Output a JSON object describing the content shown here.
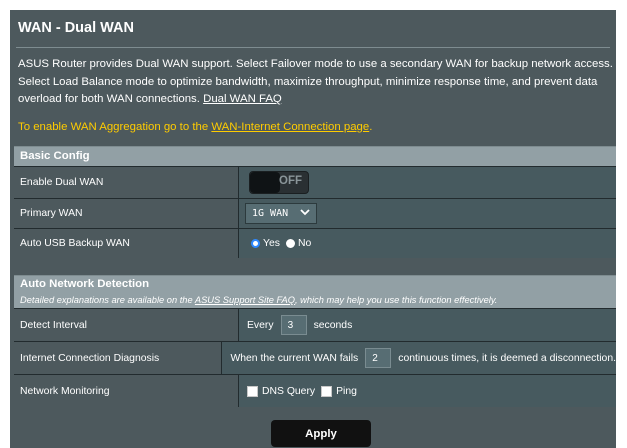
{
  "page": {
    "title": "WAN - Dual WAN",
    "description": "ASUS Router provides Dual WAN support. Select Failover mode to use a secondary WAN for backup network access. Select Load Balance mode to optimize bandwidth, maximize throughput, minimize response time, and prevent data overload for both WAN connections.",
    "faq_link": "Dual WAN FAQ",
    "aggregation_prefix": "To enable WAN Aggregation go to the",
    "aggregation_link": "WAN-Internet Connection page",
    "aggregation_suffix": "."
  },
  "basic_config": {
    "header": "Basic Config",
    "enable_dual_wan": {
      "label": "Enable Dual WAN",
      "state": "OFF"
    },
    "primary_wan": {
      "label": "Primary WAN",
      "value": "1G WAN"
    },
    "auto_usb_backup": {
      "label": "Auto USB Backup WAN",
      "yes": "Yes",
      "no": "No",
      "selected": "Yes"
    }
  },
  "auto_detection": {
    "header": "Auto Network Detection",
    "note_prefix": "Detailed explanations are available on the",
    "note_link": "ASUS Support Site FAQ",
    "note_suffix": ", which may help you use this function effectively.",
    "detect_interval": {
      "label": "Detect Interval",
      "prefix": "Every",
      "value": "3",
      "suffix": "seconds"
    },
    "diagnosis": {
      "label": "Internet Connection Diagnosis",
      "prefix": "When the current WAN fails",
      "value": "2",
      "suffix": "continuous times, it is deemed a disconnection."
    },
    "monitoring": {
      "label": "Network Monitoring",
      "dns_query": "DNS Query",
      "ping": "Ping"
    }
  },
  "actions": {
    "apply": "Apply"
  },
  "colors": {
    "panel": "#4d595d",
    "header": "#92a0a5",
    "accent": "#ffcc00"
  }
}
